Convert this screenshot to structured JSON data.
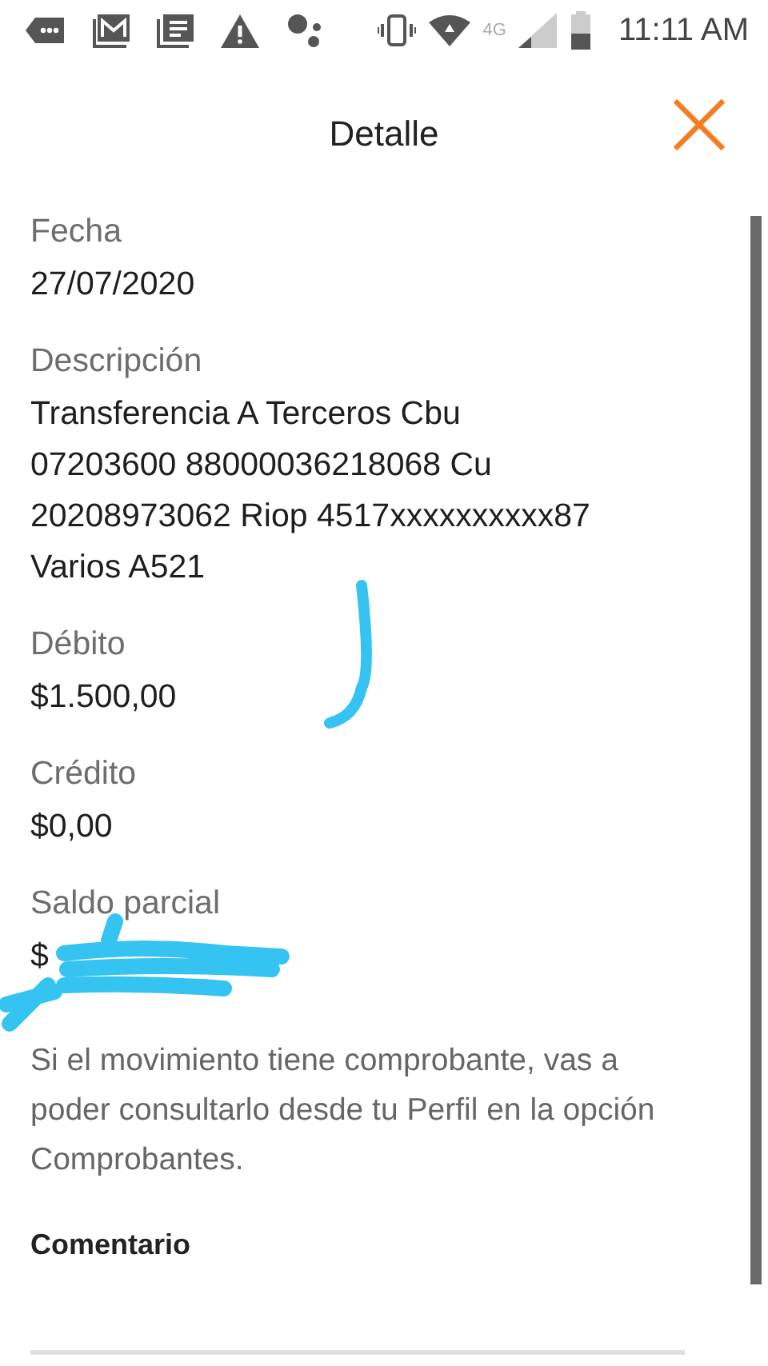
{
  "status_bar": {
    "network": "4G",
    "time": "11:11 AM"
  },
  "header": {
    "title": "Detalle"
  },
  "fields": [
    {
      "label": "Fecha",
      "lines": [
        "27/07/2020"
      ]
    },
    {
      "label": "Descripción",
      "lines": [
        "Transferencia A Terceros Cbu",
        "07203600 88000036218068 Cu",
        "20208973062 Riop 4517xxxxxxxxxx87",
        "Varios A521"
      ]
    },
    {
      "label": "Débito",
      "lines": [
        "$1.500,00"
      ]
    },
    {
      "label": "Crédito",
      "lines": [
        "$0,00"
      ]
    },
    {
      "label": "Saldo parcial",
      "lines": [
        "$"
      ]
    }
  ],
  "note": "Si el movimiento tiene comprobante, vas a poder consultarlo desde tu Perfil en la opción Comprobantes.",
  "comment": {
    "label": "Comentario"
  }
}
